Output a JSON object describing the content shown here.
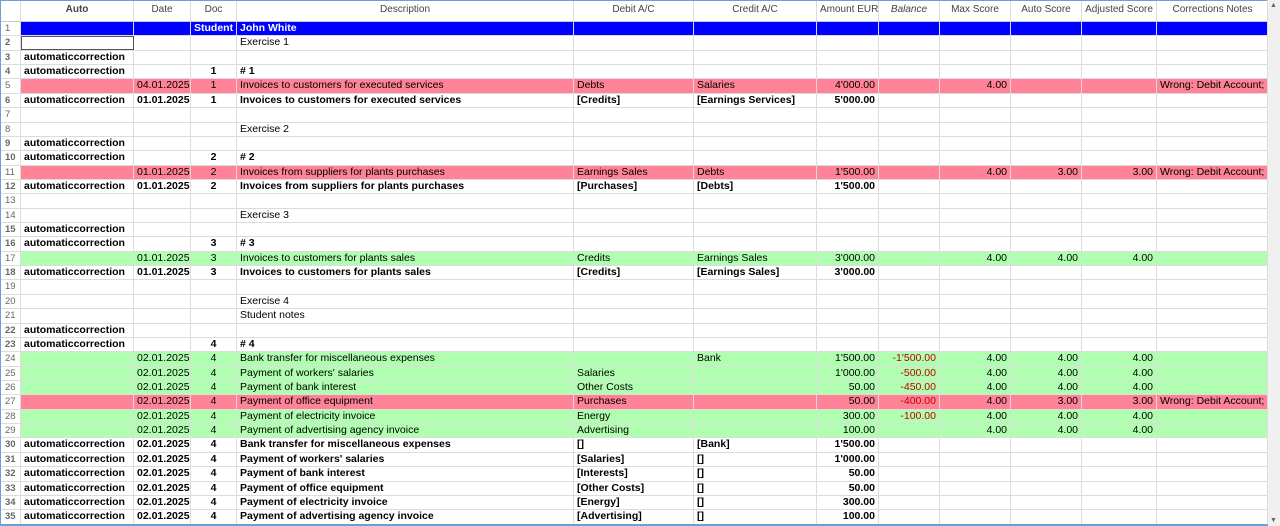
{
  "columns": [
    "Auto",
    "Date",
    "Doc",
    "Description",
    "Debit A/C",
    "Credit A/C",
    "Amount EUR",
    "Balance",
    "Max Score",
    "Auto Score",
    "Adjusted Score",
    "Corrections Notes"
  ],
  "colors": {
    "header_row": "#0000ff",
    "wrong": "#ff8296",
    "correct": "#b0ffb0",
    "negative": "#c00000"
  },
  "rows": [
    {
      "n": "1",
      "style": "blue",
      "cells": [
        "",
        "",
        "Student",
        "John White",
        "",
        "",
        "",
        "",
        "",
        "",
        "",
        ""
      ]
    },
    {
      "n": "2",
      "style": "",
      "cells": [
        "",
        "",
        "",
        "Exercise 1",
        "",
        "",
        "",
        "",
        "",
        "",
        "",
        ""
      ]
    },
    {
      "n": "3",
      "style": "bold",
      "cells": [
        "automaticcorrection",
        "",
        "",
        "",
        "",
        "",
        "",
        "",
        "",
        "",
        "",
        ""
      ]
    },
    {
      "n": "4",
      "style": "bold",
      "cells": [
        "automaticcorrection",
        "",
        "1",
        "# 1",
        "",
        "",
        "",
        "",
        "",
        "",
        "",
        ""
      ]
    },
    {
      "n": "5",
      "style": "pink",
      "cells": [
        "",
        "04.01.2025",
        "1",
        "Invoices to customers for executed services",
        "Debts",
        "Salaries",
        "4'000.00",
        "",
        "4.00",
        "",
        "",
        "Wrong: Debit Account; Cr"
      ]
    },
    {
      "n": "6",
      "style": "bold",
      "cells": [
        "automaticcorrection",
        "01.01.2025",
        "1",
        "Invoices to customers for executed services",
        "[Credits]",
        "[Earnings Services]",
        "5'000.00",
        "",
        "",
        "",
        "",
        ""
      ]
    },
    {
      "n": "7",
      "style": "",
      "cells": [
        "",
        "",
        "",
        "",
        "",
        "",
        "",
        "",
        "",
        "",
        "",
        ""
      ]
    },
    {
      "n": "8",
      "style": "",
      "cells": [
        "",
        "",
        "",
        "Exercise 2",
        "",
        "",
        "",
        "",
        "",
        "",
        "",
        ""
      ]
    },
    {
      "n": "9",
      "style": "bold",
      "cells": [
        "automaticcorrection",
        "",
        "",
        "",
        "",
        "",
        "",
        "",
        "",
        "",
        "",
        ""
      ]
    },
    {
      "n": "10",
      "style": "bold",
      "cells": [
        "automaticcorrection",
        "",
        "2",
        "# 2",
        "",
        "",
        "",
        "",
        "",
        "",
        "",
        ""
      ]
    },
    {
      "n": "11",
      "style": "pink",
      "cells": [
        "",
        "01.01.2025",
        "2",
        "Invoices from suppliers for plants purchases",
        "Earnings Sales",
        "Debts",
        "1'500.00",
        "",
        "4.00",
        "3.00",
        "3.00",
        "Wrong: Debit Account;"
      ]
    },
    {
      "n": "12",
      "style": "bold",
      "cells": [
        "automaticcorrection",
        "01.01.2025",
        "2",
        "Invoices from suppliers for plants purchases",
        "[Purchases]",
        "[Debts]",
        "1'500.00",
        "",
        "",
        "",
        "",
        ""
      ]
    },
    {
      "n": "13",
      "style": "",
      "cells": [
        "",
        "",
        "",
        "",
        "",
        "",
        "",
        "",
        "",
        "",
        "",
        ""
      ]
    },
    {
      "n": "14",
      "style": "",
      "cells": [
        "",
        "",
        "",
        "Exercise 3",
        "",
        "",
        "",
        "",
        "",
        "",
        "",
        ""
      ]
    },
    {
      "n": "15",
      "style": "bold",
      "cells": [
        "automaticcorrection",
        "",
        "",
        "",
        "",
        "",
        "",
        "",
        "",
        "",
        "",
        ""
      ]
    },
    {
      "n": "16",
      "style": "bold",
      "cells": [
        "automaticcorrection",
        "",
        "3",
        "# 3",
        "",
        "",
        "",
        "",
        "",
        "",
        "",
        ""
      ]
    },
    {
      "n": "17",
      "style": "green",
      "cells": [
        "",
        "01.01.2025",
        "3",
        "Invoices to customers for plants sales",
        "Credits",
        "Earnings Sales",
        "3'000.00",
        "",
        "4.00",
        "4.00",
        "4.00",
        ""
      ]
    },
    {
      "n": "18",
      "style": "bold",
      "cells": [
        "automaticcorrection",
        "01.01.2025",
        "3",
        "Invoices to customers for plants sales",
        "[Credits]",
        "[Earnings Sales]",
        "3'000.00",
        "",
        "",
        "",
        "",
        ""
      ]
    },
    {
      "n": "19",
      "style": "",
      "cells": [
        "",
        "",
        "",
        "",
        "",
        "",
        "",
        "",
        "",
        "",
        "",
        ""
      ]
    },
    {
      "n": "20",
      "style": "",
      "cells": [
        "",
        "",
        "",
        "Exercise 4",
        "",
        "",
        "",
        "",
        "",
        "",
        "",
        ""
      ]
    },
    {
      "n": "21",
      "style": "",
      "cells": [
        "",
        "",
        "",
        "Student notes",
        "",
        "",
        "",
        "",
        "",
        "",
        "",
        ""
      ]
    },
    {
      "n": "22",
      "style": "bold",
      "cells": [
        "automaticcorrection",
        "",
        "",
        "",
        "",
        "",
        "",
        "",
        "",
        "",
        "",
        ""
      ]
    },
    {
      "n": "23",
      "style": "bold",
      "cells": [
        "automaticcorrection",
        "",
        "4",
        "# 4",
        "",
        "",
        "",
        "",
        "",
        "",
        "",
        ""
      ]
    },
    {
      "n": "24",
      "style": "green",
      "cells": [
        "",
        "02.01.2025",
        "4",
        "Bank transfer for miscellaneous expenses",
        "",
        "Bank",
        "1'500.00",
        "-1'500.00",
        "4.00",
        "4.00",
        "4.00",
        ""
      ]
    },
    {
      "n": "25",
      "style": "green",
      "cells": [
        "",
        "02.01.2025",
        "4",
        "Payment of workers' salaries",
        "Salaries",
        "",
        "1'000.00",
        "-500.00",
        "4.00",
        "4.00",
        "4.00",
        ""
      ]
    },
    {
      "n": "26",
      "style": "green",
      "cells": [
        "",
        "02.01.2025",
        "4",
        "Payment of bank interest",
        "Other Costs",
        "",
        "50.00",
        "-450.00",
        "4.00",
        "4.00",
        "4.00",
        ""
      ]
    },
    {
      "n": "27",
      "style": "pink",
      "cells": [
        "",
        "02.01.2025",
        "4",
        "Payment of office equipment",
        "Purchases",
        "",
        "50.00",
        "-400.00",
        "4.00",
        "3.00",
        "3.00",
        "Wrong: Debit Account;"
      ]
    },
    {
      "n": "28",
      "style": "green",
      "cells": [
        "",
        "02.01.2025",
        "4",
        "Payment of electricity invoice",
        "Energy",
        "",
        "300.00",
        "-100.00",
        "4.00",
        "4.00",
        "4.00",
        ""
      ]
    },
    {
      "n": "29",
      "style": "green",
      "cells": [
        "",
        "02.01.2025",
        "4",
        "Payment of advertising agency invoice",
        "Advertising",
        "",
        "100.00",
        "",
        "4.00",
        "4.00",
        "4.00",
        ""
      ]
    },
    {
      "n": "30",
      "style": "bold",
      "cells": [
        "automaticcorrection",
        "02.01.2025",
        "4",
        "Bank transfer for miscellaneous expenses",
        "[]",
        "[Bank]",
        "1'500.00",
        "",
        "",
        "",
        "",
        ""
      ]
    },
    {
      "n": "31",
      "style": "bold",
      "cells": [
        "automaticcorrection",
        "02.01.2025",
        "4",
        "Payment of workers' salaries",
        "[Salaries]",
        "[]",
        "1'000.00",
        "",
        "",
        "",
        "",
        ""
      ]
    },
    {
      "n": "32",
      "style": "bold",
      "cells": [
        "automaticcorrection",
        "02.01.2025",
        "4",
        "Payment of bank interest",
        "[Interests]",
        "[]",
        "50.00",
        "",
        "",
        "",
        "",
        ""
      ]
    },
    {
      "n": "33",
      "style": "bold",
      "cells": [
        "automaticcorrection",
        "02.01.2025",
        "4",
        "Payment of office equipment",
        "[Other Costs]",
        "[]",
        "50.00",
        "",
        "",
        "",
        "",
        ""
      ]
    },
    {
      "n": "34",
      "style": "bold",
      "cells": [
        "automaticcorrection",
        "02.01.2025",
        "4",
        "Payment of electricity invoice",
        "[Energy]",
        "[]",
        "300.00",
        "",
        "",
        "",
        "",
        ""
      ]
    },
    {
      "n": "35",
      "style": "bold",
      "cells": [
        "automaticcorrection",
        "02.01.2025",
        "4",
        "Payment of advertising agency invoice",
        "[Advertising]",
        "[]",
        "100.00",
        "",
        "",
        "",
        "",
        ""
      ]
    }
  ]
}
